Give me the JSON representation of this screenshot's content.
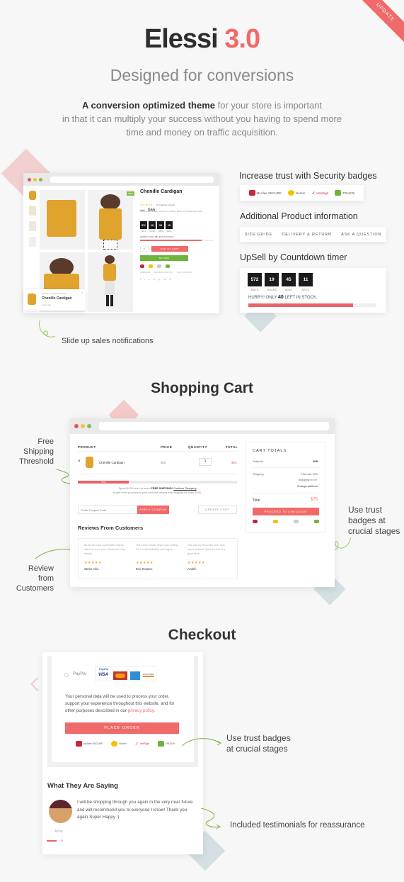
{
  "ribbon": "UPDATE",
  "header": {
    "title_main": "Elessi",
    "title_version": "3.0",
    "subtitle": "Designed for conversions",
    "intro_bold": "A conversion optimized theme",
    "intro_rest_1": " for your store is important",
    "intro_line_2": "in that it can multiply your success without you having to spend more",
    "intro_line_3": "time and money on traffic acquisition."
  },
  "colors": {
    "accent": "#f06a6a",
    "green": "#6fb33c",
    "dark": "#2e2e2e",
    "teal_diamond": "#cdd9dc",
    "pink_diamond": "#f3c9c9"
  },
  "product": {
    "name": "Chenille Cardigan",
    "reviews": "(1 customer review)",
    "old_price": "$90",
    "price": "$65",
    "description": "This pack of scoop-neck top is a fitted, fabric with elasticated cuffs.",
    "new_badge": "NEW",
    "countdown": [
      {
        "value": "571",
        "label": "DAYS"
      },
      {
        "value": "16",
        "label": "HOURS"
      },
      {
        "value": "08",
        "label": "MINS"
      },
      {
        "value": "18",
        "label": "SECS"
      }
    ],
    "stock_text_pre": "HURRY! ONLY",
    "stock_count": "35",
    "stock_text_post": "LEFT IN STOCK.",
    "qty": "1",
    "add_to_cart": "ADD TO CART",
    "buy_now": "BUY NOW",
    "links": [
      "SIZE GUIDE",
      "DELIVERY & RETURN",
      "ASK A QUESTION"
    ],
    "share_icons": [
      "twitter-icon",
      "facebook-icon",
      "pinterest-icon",
      "linkedin-icon",
      "instagram-icon",
      "vk-icon",
      "email-icon"
    ]
  },
  "notification": {
    "line1": "Tommy in US purchased a",
    "product": "Chenille Cardigan",
    "time": "1 day ago"
  },
  "features": {
    "security_title": "Increase trust with Security badges",
    "badges": [
      "McAfee SECURE",
      "Norton",
      "VeriSign",
      "TRUSTe"
    ],
    "info_title": "Additional Product information",
    "info_links": [
      "SIZE GUIDE",
      "DELIVERY & RETURN",
      "ASK A QUESTION"
    ],
    "countdown_title": "UpSell by Countdown timer",
    "countdown": [
      {
        "value": "572",
        "label": "DAYS"
      },
      {
        "value": "19",
        "label": "HOURS"
      },
      {
        "value": "45",
        "label": "MINS"
      },
      {
        "value": "11",
        "label": "SECS"
      }
    ],
    "stock_pre": "HURRY! ONLY",
    "stock_count": "40",
    "stock_post": "LEFT IN STOCK.",
    "stock_progress": 0.82
  },
  "annotations": {
    "slide_up": "Slide up sales notifications",
    "free_shipping": [
      "Free",
      "Shipping",
      "Threshold"
    ],
    "review": [
      "Review",
      "from",
      "Customers"
    ],
    "trust_cart": [
      "Use trust",
      "badges at",
      "crucial stages"
    ],
    "trust_checkout": [
      "Use trust badges",
      "at crucial stages"
    ],
    "testimonials": "Included testimonials for reassurance"
  },
  "cart": {
    "section_title": "Shopping Cart",
    "columns": [
      "PRODUCT",
      "PRICE",
      "QUANTITY",
      "TOTAL"
    ],
    "row": {
      "name": "Chenille Cardigan",
      "price": "$65",
      "qty": "1",
      "total": "$65"
    },
    "shipping_progress_label": "70%",
    "shipping_progress": 0.32,
    "spend_pre": "Spend",
    "spend_amount": "$135",
    "spend_mid": "more to reach",
    "spend_bold": "FREE SHIPPING!",
    "continue_link": "Continue Shopping",
    "spend_line2_pre": "to add more products to your cart and receive free shipping for order",
    "spend_threshold": "$200.",
    "coupon_placeholder": "Enter Coupon Code",
    "apply_coupon": "APPLY COUPON",
    "update_cart": "UPDATE CART",
    "totals_title": "CART TOTALS",
    "subtotal_label": "Subtotal",
    "subtotal": "$65",
    "shipping_label": "Shipping",
    "shipping_rate": "Flat rate: $10",
    "shipping_to": "Shipping to NY.",
    "change_address": "Change address",
    "total_label": "Total",
    "total": "$75",
    "checkout_btn": "PROCEED TO CHECKOUT",
    "badges": [
      "McAfee SECURE",
      "Norton",
      "VeriSign",
      "TRUSTe"
    ],
    "reviews_title": "Reviews From Customers",
    "reviews": [
      {
        "text": "By far the most comfortable clothes label I've ever worn. Perfect for long travels.",
        "author": "Steve Allo.",
        "stars": 5
      },
      {
        "text": "The colors exactly what I was looking for! I would definitely order again.",
        "author": "Eric Rowen.",
        "stars": 5
      },
      {
        "text": "This was my first order and I was super pleased. Quick service at a good price.",
        "author": "Ardell.",
        "stars": 5
      }
    ]
  },
  "checkout": {
    "section_title": "Checkout",
    "paypal_label": "PayPal",
    "paypal_logo": "PayPal",
    "cards": [
      "VISA",
      "MasterCard",
      "AMEX",
      "DISCOVER"
    ],
    "privacy_text": "Your personal data will be used to process your order, support your experience throughout this website, and for other purposes described in our",
    "privacy_link": "privacy policy.",
    "place_order": "PLACE ORDER",
    "badges": [
      "McAfee SECURE",
      "Norton",
      "VeriSign",
      "TRUSTe"
    ],
    "testimonials_title": "What They Are Saying",
    "testimonial_text": "I will be shopping through you again in the very near future and will recommend you to everyone I know! Thank you again Super Happy :)",
    "testimonial_author": "Anna"
  }
}
